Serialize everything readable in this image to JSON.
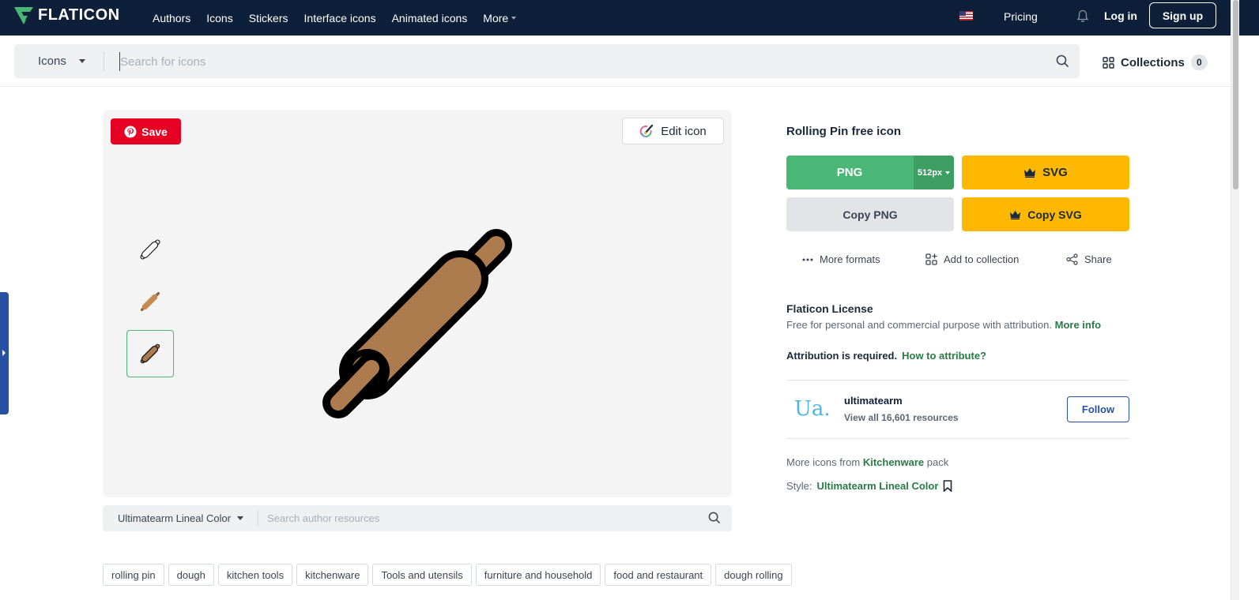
{
  "nav": {
    "logo": "FLATICON",
    "links": [
      "Authors",
      "Icons",
      "Stickers",
      "Interface icons",
      "Animated icons",
      "More"
    ],
    "pricing": "Pricing",
    "login": "Log in",
    "signup": "Sign up"
  },
  "search": {
    "type": "Icons",
    "placeholder": "Search for icons",
    "collections_label": "Collections",
    "collections_count": "0"
  },
  "preview": {
    "save_label": "Save",
    "edit_label": "Edit icon",
    "style_select": "Ultimatearm Lineal Color",
    "author_search_placeholder": "Search author resources"
  },
  "detail": {
    "title": "Rolling Pin free icon",
    "png_label": "PNG",
    "png_size": "512px",
    "svg_label": "SVG",
    "copy_png_label": "Copy PNG",
    "copy_svg_label": "Copy SVG",
    "more_formats": "More formats",
    "add_to_collection": "Add to collection",
    "share": "Share"
  },
  "license": {
    "title": "Flaticon License",
    "text": "Free for personal and commercial purpose with attribution.",
    "more_info": "More info",
    "attribution": "Attribution is required.",
    "how_to": "How to attribute?"
  },
  "author": {
    "logo_text": "Ua.",
    "name": "ultimatearm",
    "resources": "View all 16,601 resources",
    "follow": "Follow"
  },
  "pack": {
    "prefix": "More icons from",
    "name": "Kitchenware",
    "suffix": "pack"
  },
  "style": {
    "label": "Style:",
    "name": "Ultimatearm Lineal Color"
  },
  "tags": [
    "rolling pin",
    "dough",
    "kitchen tools",
    "kitchenware",
    "Tools and utensils",
    "furniture and household",
    "food and restaurant",
    "dough rolling"
  ],
  "colors": {
    "nav_bg": "#0e1f3a",
    "png_green": "#4ab776",
    "svg_yellow": "#ffb800",
    "pinterest_red": "#e60023",
    "link_green": "#2a7a45",
    "follow_blue": "#2851a3",
    "rolling_pin_brown": "#ad7b4d"
  }
}
